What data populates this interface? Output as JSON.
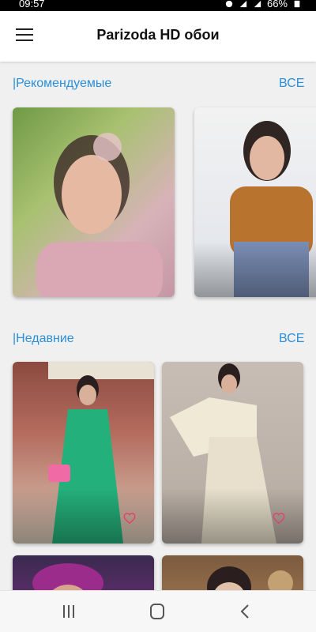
{
  "status": {
    "time": "09:57",
    "battery": "66%"
  },
  "app": {
    "title": "Parizoda HD обои"
  },
  "recommended": {
    "title": "|Рекомендуемые",
    "all": "ВСЕ"
  },
  "recent": {
    "title": "|Недавние",
    "all": "ВСЕ"
  }
}
